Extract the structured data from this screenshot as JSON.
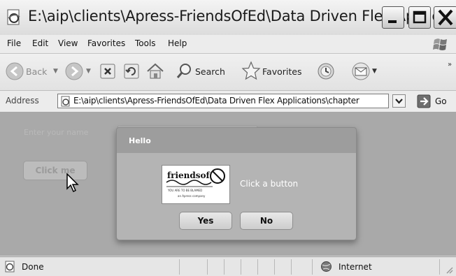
{
  "window": {
    "title": "E:\\aip\\clients\\Apress-FriendsOfEd\\Data Driven Flex Applicat..."
  },
  "menu": {
    "items": [
      "File",
      "Edit",
      "View",
      "Favorites",
      "Tools",
      "Help"
    ]
  },
  "toolbar": {
    "back_label": "Back",
    "search_label": "Search",
    "favorites_label": "Favorites"
  },
  "address": {
    "label": "Address",
    "value": "E:\\aip\\clients\\Apress-FriendsOfEd\\Data Driven Flex Applications\\chapter",
    "go_label": "Go"
  },
  "content": {
    "name_label": "Enter your name",
    "name_value": "",
    "click_button_label": "Click me"
  },
  "dialog": {
    "title": "Hello",
    "message": "Click a button",
    "yes_label": "Yes",
    "no_label": "No",
    "logo": {
      "brand": "friendsof",
      "tagline": "YOU ARE TO BE BLAMED",
      "subtag": "an Apress company"
    }
  },
  "status": {
    "text": "Done",
    "zone": "Internet"
  },
  "colors": {
    "content_bg": "#a9a9a9",
    "dialog_bg": "#9d9d9d"
  }
}
